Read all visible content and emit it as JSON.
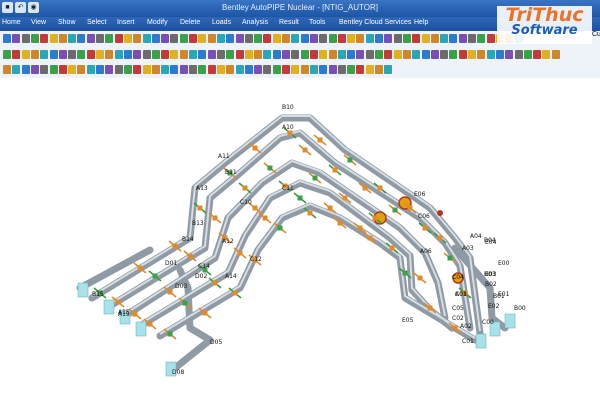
{
  "window": {
    "title": "Bentley AutoPIPE Nuclear - [NTIG_AUTOR]"
  },
  "quick_access": [
    "save-icon",
    "undo-icon",
    "circle-icon"
  ],
  "menu": [
    "Home",
    "View",
    "Show",
    "Select",
    "Insert",
    "Modify",
    "Delete",
    "Loads",
    "Analysis",
    "Result",
    "Tools",
    "Bentley Cloud Services",
    "Help"
  ],
  "logo": {
    "line1": "TriThuc",
    "line2": "Software",
    "tail": "Cu"
  },
  "nodes": [
    "B10",
    "A10",
    "A11",
    "B11",
    "A13",
    "B13",
    "C10",
    "C11",
    "C12",
    "C14",
    "A15",
    "B14",
    "D05",
    "D01",
    "D02",
    "D03",
    "D08",
    "A14",
    "A19",
    "A12",
    "B15",
    "E00",
    "E01",
    "E02",
    "E03",
    "E04",
    "E05",
    "E06",
    "B01",
    "B02",
    "B03",
    "B04",
    "B00",
    "A04",
    "A03",
    "A01",
    "A02",
    "C05",
    "C04",
    "C03",
    "C02",
    "C01",
    "C00",
    "C06",
    "A06"
  ],
  "colors": {
    "pipe": "#b9c3cc",
    "support": "#e08a2a",
    "anchor": "#a8e1e8",
    "valve": "#e0a010"
  }
}
